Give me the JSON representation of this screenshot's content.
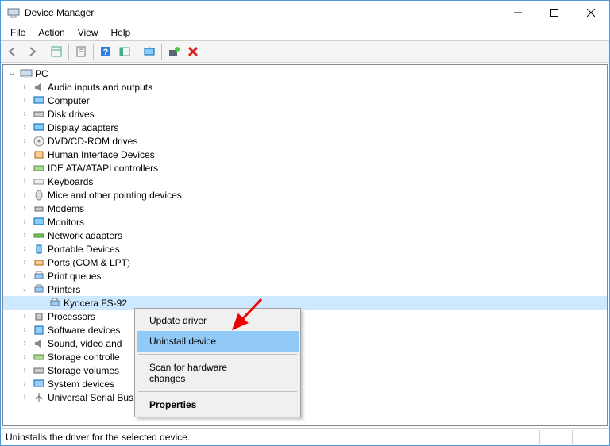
{
  "titlebar": {
    "title": "Device Manager"
  },
  "menu": {
    "file": "File",
    "action": "Action",
    "view": "View",
    "help": "Help"
  },
  "tree": {
    "root": "PC",
    "categories": [
      "Audio inputs and outputs",
      "Computer",
      "Disk drives",
      "Display adapters",
      "DVD/CD-ROM drives",
      "Human Interface Devices",
      "IDE ATA/ATAPI controllers",
      "Keyboards",
      "Mice and other pointing devices",
      "Modems",
      "Monitors",
      "Network adapters",
      "Portable Devices",
      "Ports (COM & LPT)",
      "Print queues",
      "Printers",
      "Processors",
      "Software devices",
      "Sound, video and",
      "Storage controlle",
      "Storage volumes",
      "System devices",
      "Universal Serial Bus controllers"
    ],
    "printer_device": "Kyocera FS-92"
  },
  "contextmenu": {
    "update": "Update driver",
    "uninstall": "Uninstall device",
    "scan": "Scan for hardware changes",
    "properties": "Properties"
  },
  "statusbar": {
    "text": "Uninstalls the driver for the selected device."
  }
}
